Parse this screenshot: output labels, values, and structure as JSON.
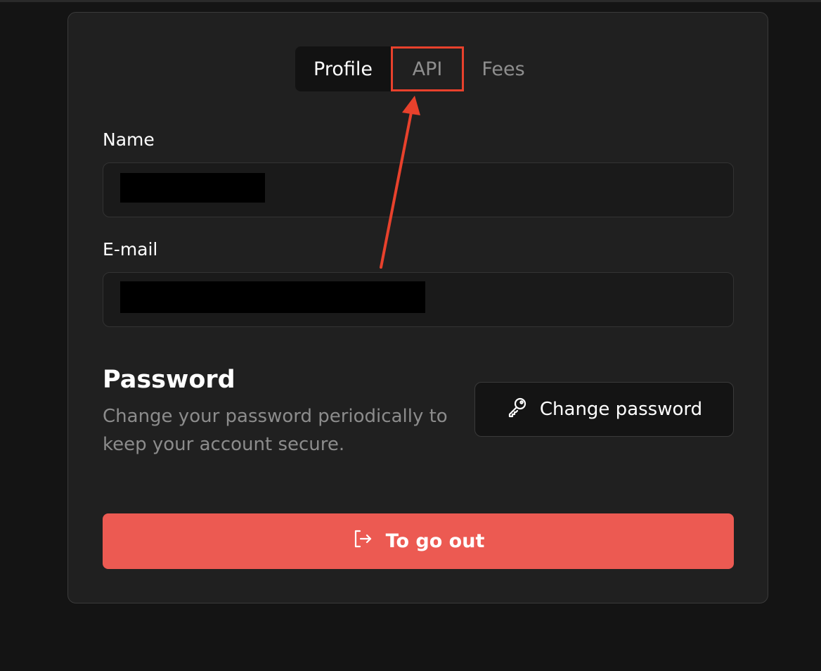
{
  "tabs": [
    {
      "label": "Profile",
      "active": true
    },
    {
      "label": "API",
      "active": false,
      "highlighted": true
    },
    {
      "label": "Fees",
      "active": false
    }
  ],
  "profile": {
    "name_label": "Name",
    "email_label": "E-mail"
  },
  "password": {
    "title": "Password",
    "description": "Change your password periodically to keep your account secure.",
    "button_label": "Change password",
    "button_icon": "key-icon"
  },
  "logout": {
    "label": "To go out",
    "icon": "logout-icon",
    "color": "#ec5a52"
  },
  "annotation": {
    "color": "#e8412c",
    "icon": "arrow-up-icon"
  }
}
